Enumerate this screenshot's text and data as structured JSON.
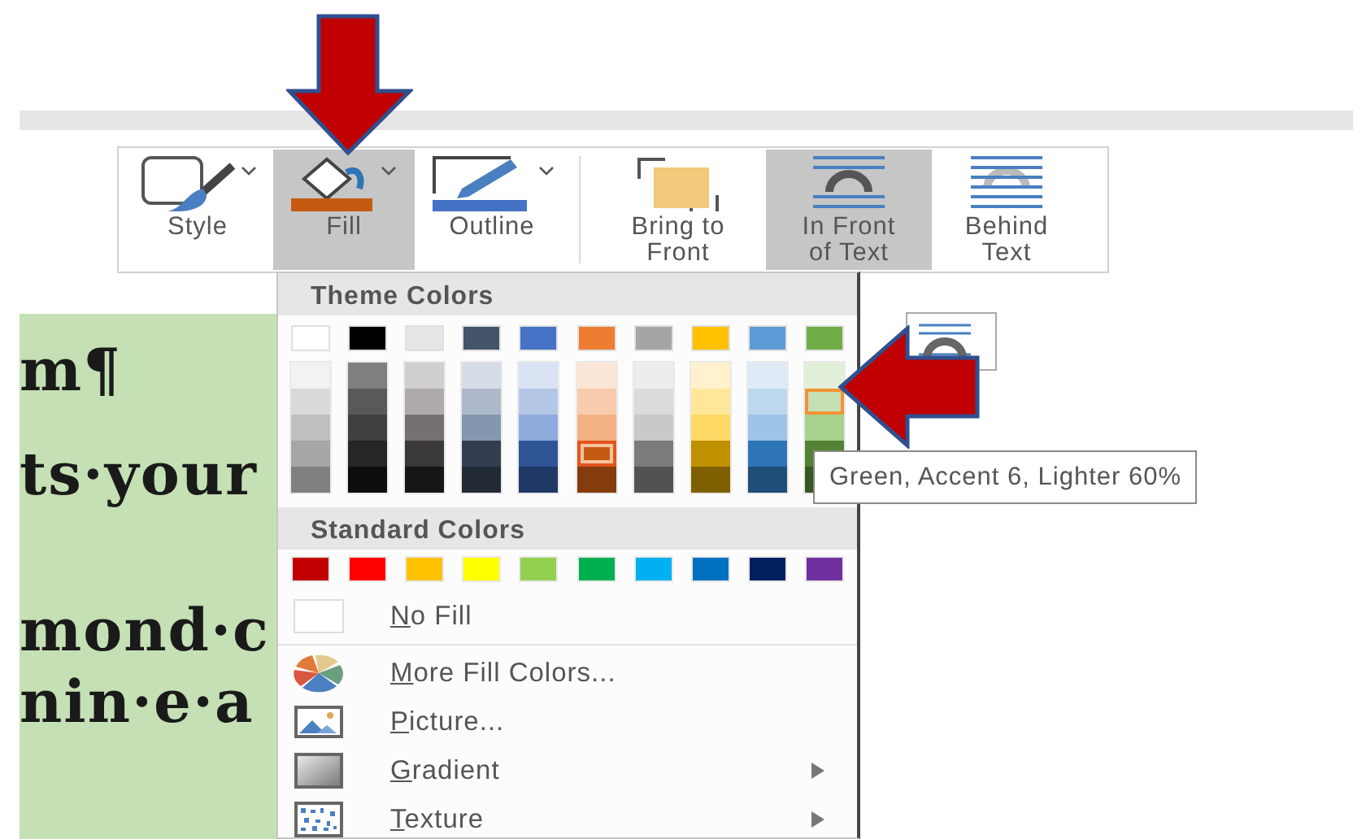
{
  "ribbon": {
    "buttons": [
      {
        "label": "Style",
        "kind": "style",
        "dropdown": true,
        "selected": false
      },
      {
        "label": "Fill",
        "kind": "fill",
        "dropdown": true,
        "selected": true
      },
      {
        "label": "Outline",
        "kind": "outline",
        "dropdown": true,
        "selected": false
      },
      {
        "label": "Bring to Front",
        "kind": "bring_front",
        "dropdown": false,
        "selected": false
      },
      {
        "label": "In Front of Text",
        "kind": "in_front",
        "dropdown": false,
        "selected": true
      },
      {
        "label": "Behind Text",
        "kind": "behind",
        "dropdown": false,
        "selected": false
      }
    ]
  },
  "document": {
    "lines": [
      "m¶",
      "ts·your",
      "mond·c",
      "nin·e·a"
    ]
  },
  "fill_menu": {
    "theme_header": "Theme Colors",
    "theme_colors": [
      {
        "color": "#ffffff",
        "selected": false,
        "shades": [
          {
            "color": "#f2f2f2",
            "selected": false,
            "hovered": false
          },
          {
            "color": "#d9d9d9",
            "selected": false,
            "hovered": false
          },
          {
            "color": "#bfbfbf",
            "selected": false,
            "hovered": false
          },
          {
            "color": "#a6a6a6",
            "selected": false,
            "hovered": false
          },
          {
            "color": "#808080",
            "selected": false,
            "hovered": false
          }
        ]
      },
      {
        "color": "#000000",
        "selected": false,
        "shades": [
          {
            "color": "#7f7f7f",
            "selected": false,
            "hovered": false
          },
          {
            "color": "#595959",
            "selected": false,
            "hovered": false
          },
          {
            "color": "#404040",
            "selected": false,
            "hovered": false
          },
          {
            "color": "#262626",
            "selected": false,
            "hovered": false
          },
          {
            "color": "#0d0d0d",
            "selected": false,
            "hovered": false
          }
        ]
      },
      {
        "color": "#e7e6e6",
        "selected": false,
        "shades": [
          {
            "color": "#d0cece",
            "selected": false,
            "hovered": false
          },
          {
            "color": "#aeaaaa",
            "selected": false,
            "hovered": false
          },
          {
            "color": "#757171",
            "selected": false,
            "hovered": false
          },
          {
            "color": "#3a3838",
            "selected": false,
            "hovered": false
          },
          {
            "color": "#161616",
            "selected": false,
            "hovered": false
          }
        ]
      },
      {
        "color": "#44546a",
        "selected": false,
        "shades": [
          {
            "color": "#d6dce5",
            "selected": false,
            "hovered": false
          },
          {
            "color": "#adb9ca",
            "selected": false,
            "hovered": false
          },
          {
            "color": "#8497b0",
            "selected": false,
            "hovered": false
          },
          {
            "color": "#333f50",
            "selected": false,
            "hovered": false
          },
          {
            "color": "#222a35",
            "selected": false,
            "hovered": false
          }
        ]
      },
      {
        "color": "#4472c4",
        "selected": false,
        "shades": [
          {
            "color": "#dae3f3",
            "selected": false,
            "hovered": false
          },
          {
            "color": "#b4c7e7",
            "selected": false,
            "hovered": false
          },
          {
            "color": "#8faadc",
            "selected": false,
            "hovered": false
          },
          {
            "color": "#2f5597",
            "selected": false,
            "hovered": false
          },
          {
            "color": "#203864",
            "selected": false,
            "hovered": false
          }
        ]
      },
      {
        "color": "#ed7d31",
        "selected": false,
        "shades": [
          {
            "color": "#fbe5d6",
            "selected": false,
            "hovered": false
          },
          {
            "color": "#f8cbad",
            "selected": false,
            "hovered": false
          },
          {
            "color": "#f4b183",
            "selected": false,
            "hovered": false
          },
          {
            "color": "#c55a11",
            "selected": true,
            "hovered": false
          },
          {
            "color": "#843c0c",
            "selected": false,
            "hovered": false
          }
        ]
      },
      {
        "color": "#a5a5a5",
        "selected": false,
        "shades": [
          {
            "color": "#ededed",
            "selected": false,
            "hovered": false
          },
          {
            "color": "#dbdbdb",
            "selected": false,
            "hovered": false
          },
          {
            "color": "#c9c9c9",
            "selected": false,
            "hovered": false
          },
          {
            "color": "#7b7b7b",
            "selected": false,
            "hovered": false
          },
          {
            "color": "#525252",
            "selected": false,
            "hovered": false
          }
        ]
      },
      {
        "color": "#ffc000",
        "selected": false,
        "shades": [
          {
            "color": "#fff2cc",
            "selected": false,
            "hovered": false
          },
          {
            "color": "#ffe699",
            "selected": false,
            "hovered": false
          },
          {
            "color": "#ffd966",
            "selected": false,
            "hovered": false
          },
          {
            "color": "#bf9000",
            "selected": false,
            "hovered": false
          },
          {
            "color": "#7f6000",
            "selected": false,
            "hovered": false
          }
        ]
      },
      {
        "color": "#5b9bd5",
        "selected": false,
        "shades": [
          {
            "color": "#deebf7",
            "selected": false,
            "hovered": false
          },
          {
            "color": "#bdd7ee",
            "selected": false,
            "hovered": false
          },
          {
            "color": "#9dc3e6",
            "selected": false,
            "hovered": false
          },
          {
            "color": "#2e75b6",
            "selected": false,
            "hovered": false
          },
          {
            "color": "#1f4e79",
            "selected": false,
            "hovered": false
          }
        ]
      },
      {
        "color": "#70ad47",
        "selected": false,
        "shades": [
          {
            "color": "#e2f0d9",
            "selected": false,
            "hovered": false
          },
          {
            "color": "#c5e0b4",
            "selected": false,
            "hovered": true
          },
          {
            "color": "#a9d18e",
            "selected": false,
            "hovered": false
          },
          {
            "color": "#548235",
            "selected": false,
            "hovered": false
          },
          {
            "color": "#385723",
            "selected": false,
            "hovered": false
          }
        ]
      }
    ],
    "standard_header": "Standard Colors",
    "standard_colors": [
      {
        "color": "#c00000",
        "selected": false
      },
      {
        "color": "#ff0000",
        "selected": false
      },
      {
        "color": "#ffc000",
        "selected": false
      },
      {
        "color": "#ffff00",
        "selected": false
      },
      {
        "color": "#92d050",
        "selected": false
      },
      {
        "color": "#00b050",
        "selected": false
      },
      {
        "color": "#00b0f0",
        "selected": false
      },
      {
        "color": "#0070c0",
        "selected": false
      },
      {
        "color": "#002060",
        "selected": false
      },
      {
        "color": "#7030a0",
        "selected": false
      }
    ],
    "items": [
      {
        "label": "No Fill",
        "kind": "no_fill",
        "submenu": false
      },
      {
        "label": "More Fill Colors...",
        "kind": "more_colors",
        "submenu": false
      },
      {
        "label": "Picture...",
        "kind": "picture",
        "submenu": false
      },
      {
        "label": "Gradient",
        "kind": "gradient",
        "submenu": true
      },
      {
        "label": "Texture",
        "kind": "texture",
        "submenu": true
      }
    ]
  },
  "tooltip": "Green, Accent 6, Lighter 60%"
}
